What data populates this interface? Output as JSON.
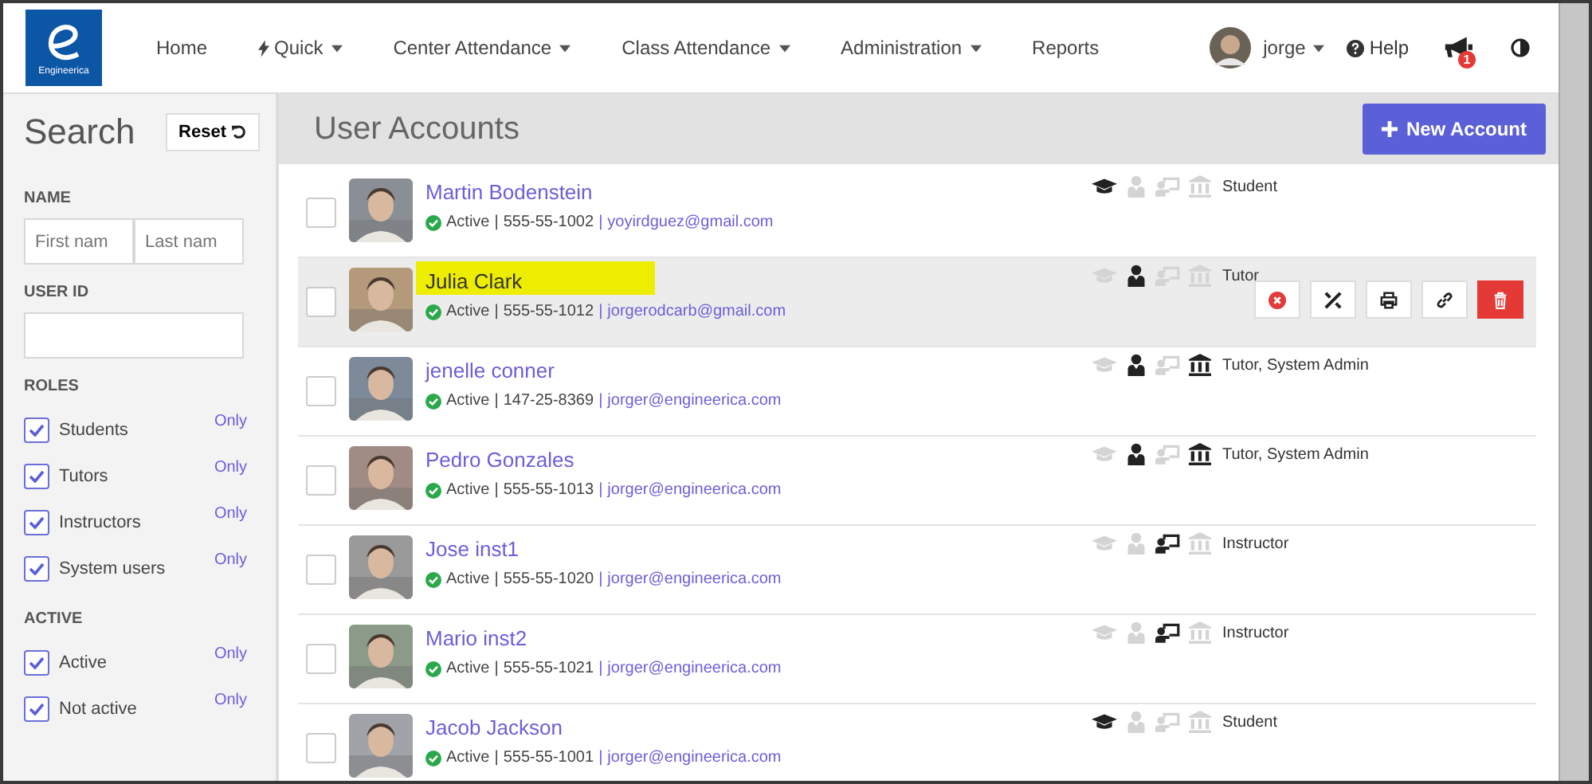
{
  "logo": {
    "text": "Engineerica"
  },
  "nav": [
    {
      "label": "Home",
      "has_menu": false
    },
    {
      "label": "Quick",
      "has_menu": true
    },
    {
      "label": "Center Attendance",
      "has_menu": true
    },
    {
      "label": "Class Attendance",
      "has_menu": true
    },
    {
      "label": "Administration",
      "has_menu": true
    },
    {
      "label": "Reports",
      "has_menu": false
    }
  ],
  "separator": "|",
  "user": {
    "name": "jorge"
  },
  "help": {
    "label": "Help"
  },
  "notifications": {
    "count": "1"
  },
  "search": {
    "title": "Search",
    "reset": "Reset",
    "name_label": "NAME",
    "first_placeholder": "First nam",
    "last_placeholder": "Last nam",
    "user_id_label": "USER ID",
    "roles_label": "ROLES",
    "roles": [
      {
        "label": "Students",
        "checked": true,
        "only": "Only"
      },
      {
        "label": "Tutors",
        "checked": true,
        "only": "Only"
      },
      {
        "label": "Instructors",
        "checked": true,
        "only": "Only"
      },
      {
        "label": "System users",
        "checked": true,
        "only": "Only"
      }
    ],
    "active_label": "ACTIVE",
    "active": [
      {
        "label": "Active",
        "checked": true,
        "only": "Only"
      },
      {
        "label": "Not active",
        "checked": true,
        "only": "Only"
      }
    ]
  },
  "page": {
    "title": "User Accounts",
    "new_button": "New Account"
  },
  "users": [
    {
      "name": "Martin Bodenstein",
      "status": "Active",
      "phone": "555-55-1002",
      "email": "yoyirdguez@gmail.com",
      "roles": {
        "student": true,
        "tutor": false,
        "instructor": false,
        "admin": false
      },
      "role_text": "Student",
      "checked": false,
      "hovered": false
    },
    {
      "name": "Julia Clark",
      "status": "Active",
      "phone": "555-55-1012",
      "email": "jorgerodcarb@gmail.com",
      "roles": {
        "student": false,
        "tutor": true,
        "instructor": false,
        "admin": false
      },
      "role_text": "Tutor",
      "checked": false,
      "hovered": true
    },
    {
      "name": "jenelle conner",
      "status": "Active",
      "phone": "147-25-8369",
      "email": "jorger@engineerica.com",
      "roles": {
        "student": false,
        "tutor": true,
        "instructor": false,
        "admin": true
      },
      "role_text": "Tutor, System Admin",
      "checked": false,
      "hovered": false
    },
    {
      "name": "Pedro Gonzales",
      "status": "Active",
      "phone": "555-55-1013",
      "email": "jorger@engineerica.com",
      "roles": {
        "student": false,
        "tutor": true,
        "instructor": false,
        "admin": true
      },
      "role_text": "Tutor, System Admin",
      "checked": false,
      "hovered": false
    },
    {
      "name": "Jose inst1",
      "status": "Active",
      "phone": "555-55-1020",
      "email": "jorger@engineerica.com",
      "roles": {
        "student": false,
        "tutor": false,
        "instructor": true,
        "admin": false
      },
      "role_text": "Instructor",
      "checked": false,
      "hovered": false
    },
    {
      "name": "Mario inst2",
      "status": "Active",
      "phone": "555-55-1021",
      "email": "jorger@engineerica.com",
      "roles": {
        "student": false,
        "tutor": false,
        "instructor": true,
        "admin": false
      },
      "role_text": "Instructor",
      "checked": false,
      "hovered": false
    },
    {
      "name": "Jacob Jackson",
      "status": "Active",
      "phone": "555-55-1001",
      "email": "jorger@engineerica.com",
      "roles": {
        "student": true,
        "tutor": false,
        "instructor": false,
        "admin": false
      },
      "role_text": "Student",
      "checked": false,
      "hovered": false
    }
  ]
}
